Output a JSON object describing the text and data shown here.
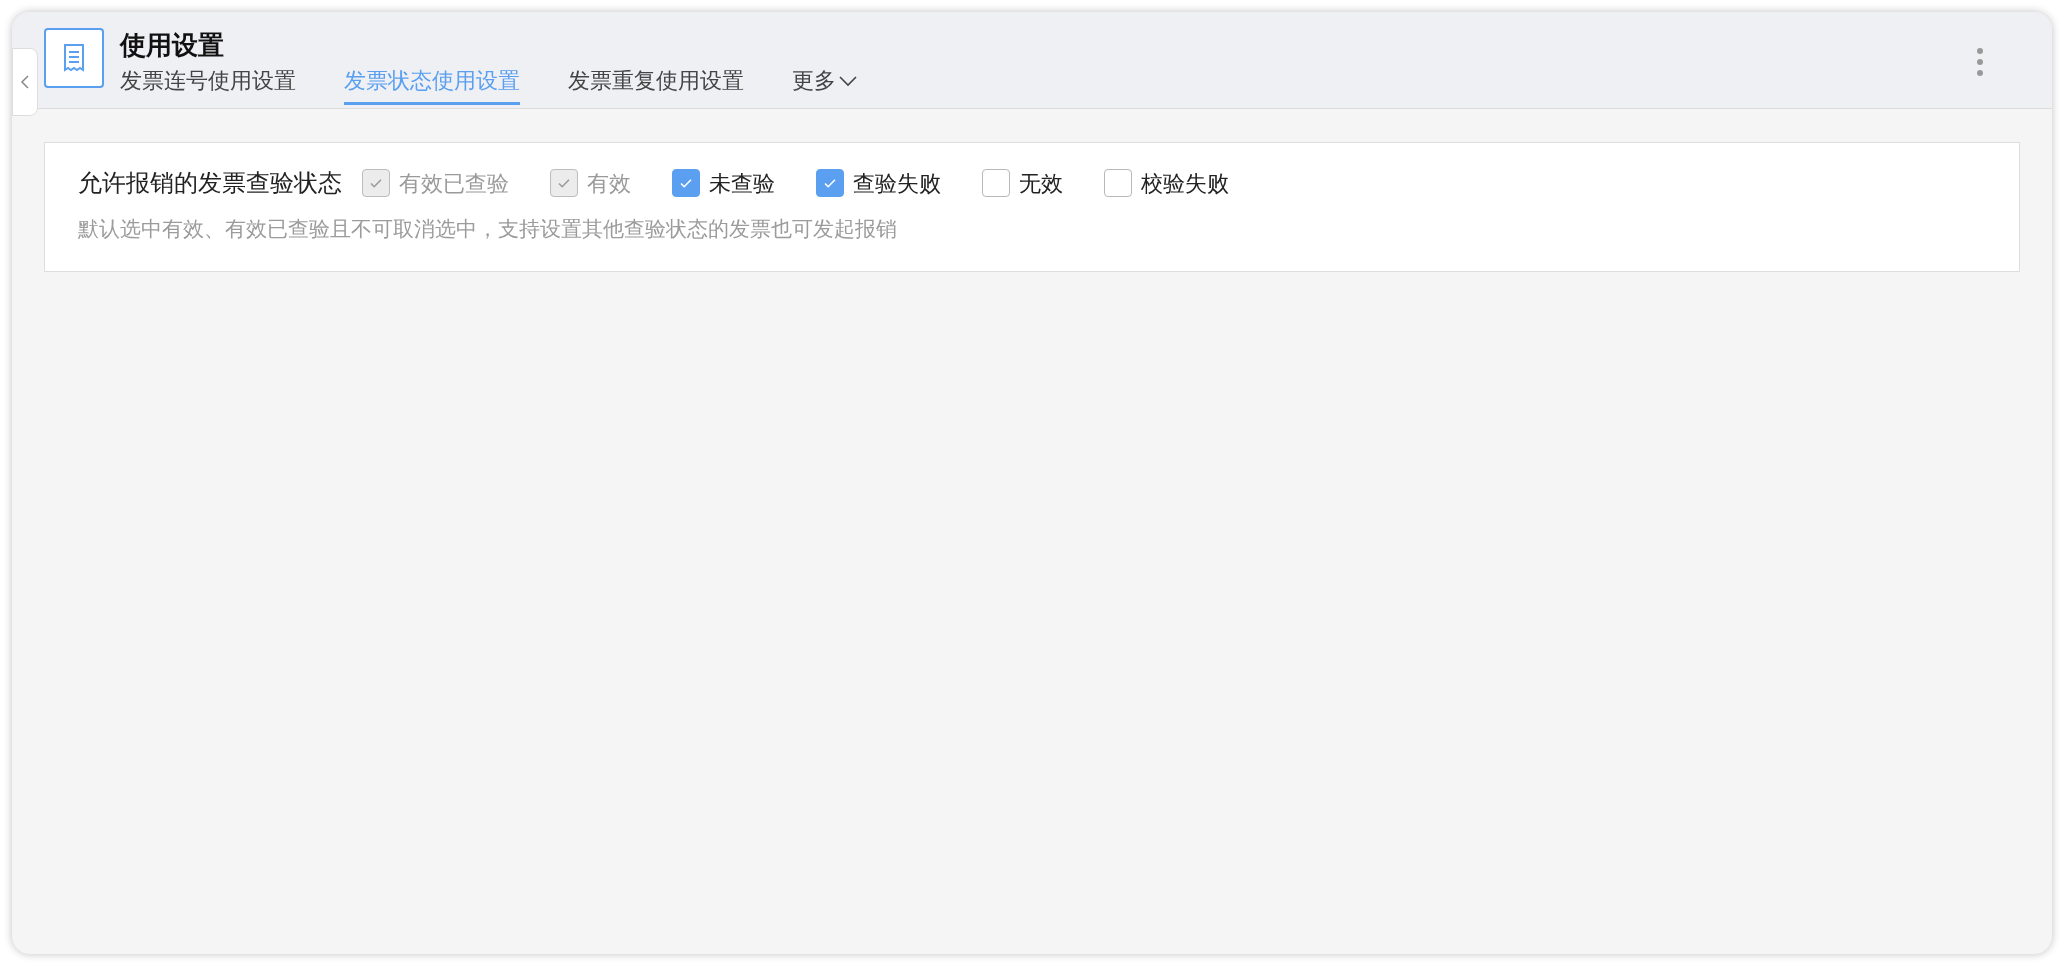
{
  "header": {
    "title": "使用设置",
    "tabs": [
      {
        "label": "发票连号使用设置",
        "selected": false
      },
      {
        "label": "发票状态使用设置",
        "selected": true
      },
      {
        "label": "发票重复使用设置",
        "selected": false
      }
    ],
    "more": "更多"
  },
  "setting": {
    "label": "允许报销的发票查验状态",
    "options": [
      {
        "label": "有效已查验",
        "checked": true,
        "disabled": true
      },
      {
        "label": "有效",
        "checked": true,
        "disabled": true
      },
      {
        "label": "未查验",
        "checked": true,
        "disabled": false
      },
      {
        "label": "查验失败",
        "checked": true,
        "disabled": false
      },
      {
        "label": "无效",
        "checked": false,
        "disabled": false
      },
      {
        "label": "校验失败",
        "checked": false,
        "disabled": false
      }
    ],
    "hint": "默认选中有效、有效已查验且不可取消选中，支持设置其他查验状态的发票也可发起报销"
  }
}
